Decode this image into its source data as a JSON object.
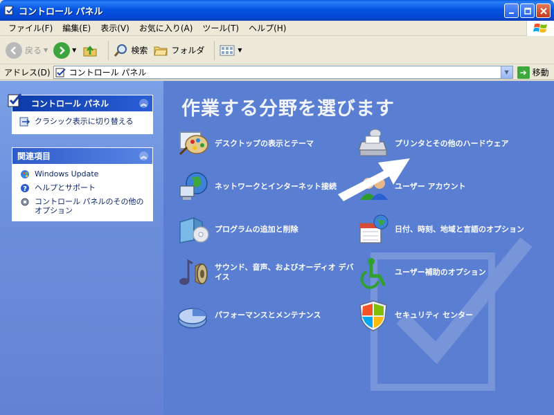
{
  "window": {
    "title": "コントロール パネル"
  },
  "menu": {
    "items": [
      "ファイル(F)",
      "編集(E)",
      "表示(V)",
      "お気に入り(A)",
      "ツール(T)",
      "ヘルプ(H)"
    ]
  },
  "toolbar": {
    "back_label": "戻る",
    "search_label": "検索",
    "folders_label": "フォルダ"
  },
  "address": {
    "label": "アドレス(D)",
    "value": "コントロール パネル",
    "go_label": "移動"
  },
  "leftpane": {
    "panel1": {
      "title": "コントロール パネル",
      "link": "クラシック表示に切り替える"
    },
    "panel2": {
      "title": "関連項目",
      "links": [
        "Windows Update",
        "ヘルプとサポート",
        "コントロール パネルのその他のオプション"
      ]
    }
  },
  "main": {
    "heading": "作業する分野を選びます",
    "categories": [
      {
        "label": "デスクトップの表示とテーマ",
        "icon": "desktop-theme-icon"
      },
      {
        "label": "プリンタとその他のハードウェア",
        "icon": "printer-icon"
      },
      {
        "label": "ネットワークとインターネット接続",
        "icon": "network-icon"
      },
      {
        "label": "ユーザー アカウント",
        "icon": "user-accounts-icon"
      },
      {
        "label": "プログラムの追加と削除",
        "icon": "add-remove-programs-icon"
      },
      {
        "label": "日付、時刻、地域と言語のオプション",
        "icon": "date-time-icon"
      },
      {
        "label": "サウンド、音声、およびオーディオ デバイス",
        "icon": "sound-icon"
      },
      {
        "label": "ユーザー補助のオプション",
        "icon": "accessibility-icon"
      },
      {
        "label": "パフォーマンスとメンテナンス",
        "icon": "performance-icon"
      },
      {
        "label": "セキュリティ センター",
        "icon": "security-center-icon"
      }
    ]
  },
  "colors": {
    "title_bar": "#0554e3",
    "main_bg": "#5a7ed2",
    "left_pane_bg": "#6c8fdb"
  }
}
